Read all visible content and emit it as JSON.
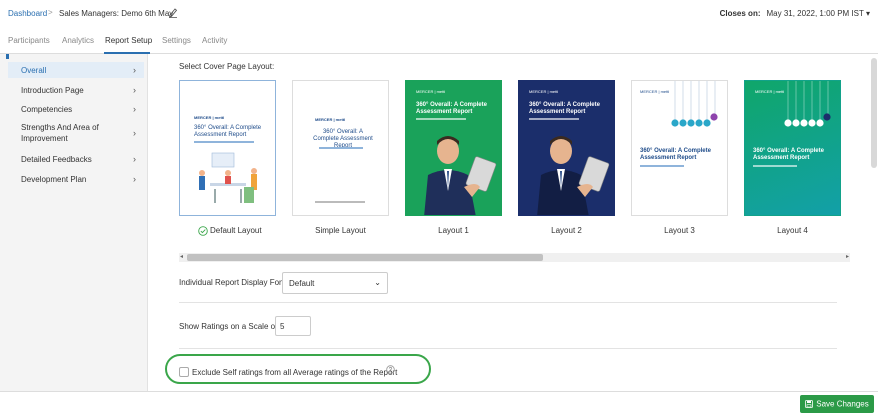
{
  "breadcrumb": {
    "dashboard": "Dashboard",
    "separator": ">",
    "title": "Sales Managers: Demo 6th May"
  },
  "closes": {
    "label": "Closes on:",
    "value": "May 31, 2022, 1:00 PM IST",
    "caret": "▾"
  },
  "tabs": [
    {
      "label": "Participants",
      "active": false
    },
    {
      "label": "Analytics",
      "active": false
    },
    {
      "label": "Report Setup",
      "active": true
    },
    {
      "label": "Settings",
      "active": false
    },
    {
      "label": "Activity",
      "active": false
    }
  ],
  "sidebar": {
    "items": [
      {
        "label": "Overall",
        "active": true
      },
      {
        "label": "Introduction Page",
        "active": false
      },
      {
        "label": "Competencies",
        "active": false
      },
      {
        "label": "Strengths And Area of Improvement",
        "active": false
      },
      {
        "label": "Detailed Feedbacks",
        "active": false
      },
      {
        "label": "Development Plan",
        "active": false
      }
    ],
    "chevron": "›"
  },
  "cover": {
    "label": "Select Cover Page Layout:",
    "layouts": [
      {
        "label": "Default Layout",
        "selected": true,
        "style": "light-illustration",
        "title": "360° Overall: A Complete Assessment Report",
        "logos": "MERCER | mettl"
      },
      {
        "label": "Simple Layout",
        "selected": false,
        "style": "light",
        "title": "360° Overall: A Complete Assessment Report",
        "logos": "MERCER | mettl"
      },
      {
        "label": "Layout 1",
        "selected": false,
        "style": "photo-green",
        "title": "360° Overall: A Complete Assessment Report",
        "logos": "MERCER | mettl"
      },
      {
        "label": "Layout 2",
        "selected": false,
        "style": "photo-navy",
        "title": "360° Overall: A Complete Assessment Report",
        "logos": "MERCER | mettl"
      },
      {
        "label": "Layout 3",
        "selected": false,
        "style": "pendulum-white",
        "title": "360° Overall: A Complete Assessment Report",
        "logos": "MERCER | mettl"
      },
      {
        "label": "Layout 4",
        "selected": false,
        "style": "pendulum-green",
        "title": "360° Overall: A Complete Assessment Report",
        "logos": "MERCER | mettl"
      }
    ],
    "scroll_left": "◂",
    "scroll_right": "▸"
  },
  "font": {
    "label": "Individual Report Display Font:",
    "value": "Default",
    "caret": "⌄"
  },
  "scale": {
    "label": "Show Ratings on a Scale of:",
    "value": "5"
  },
  "exclude": {
    "label": "Exclude Self ratings from all Average ratings of the Report",
    "checked": false
  },
  "save": {
    "label": "Save Changes"
  },
  "colors": {
    "primary": "#2a6fb0",
    "save_green": "#2b9a47",
    "highlight_oval": "#3aa64a",
    "cover_green": "#1aa25a",
    "cover_navy": "#1b2e6b"
  }
}
